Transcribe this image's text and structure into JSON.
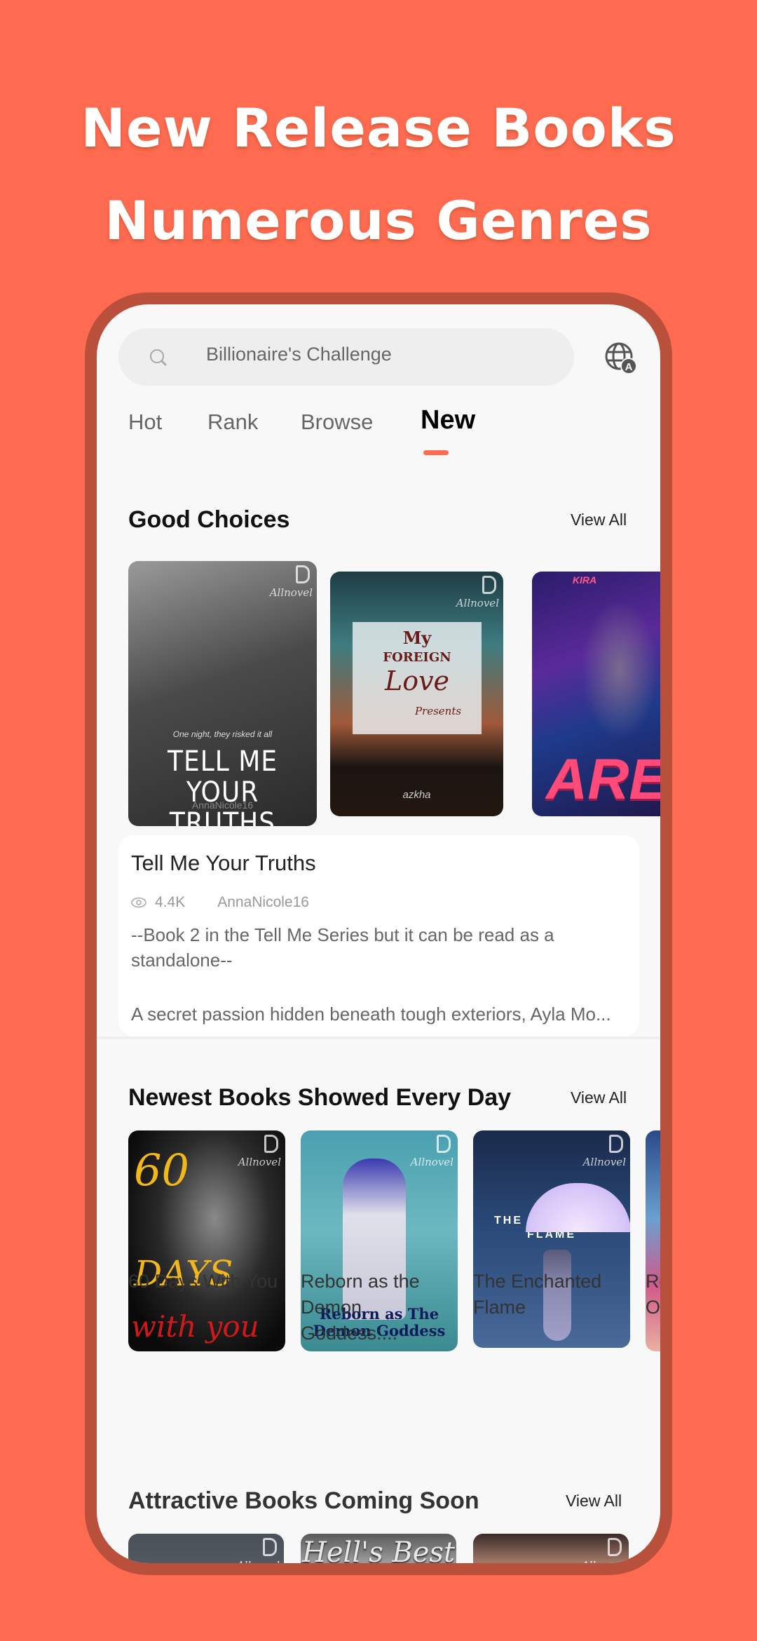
{
  "promo": {
    "line1": "New Release Books",
    "line2": "Numerous Genres",
    "background_color": "#FF6B50"
  },
  "search": {
    "icon": "search-icon",
    "value": "Billionaire's Challenge"
  },
  "language_button": {
    "icon": "globe-language-icon",
    "badge": "A"
  },
  "tabs": [
    {
      "label": "Hot",
      "active": false
    },
    {
      "label": "Rank",
      "active": false
    },
    {
      "label": "Browse",
      "active": false
    },
    {
      "label": "New",
      "active": true
    }
  ],
  "accent_color": "#FF6B50",
  "good_choices": {
    "title": "Good Choices",
    "view_all": "View All",
    "covers": [
      {
        "brand": "Allnovel",
        "tagline": "One night, they risked it all",
        "cover_title": "TELL ME YOUR TRUTHS",
        "cover_author": "AnnaNicole16"
      },
      {
        "brand": "Allnovel",
        "cover_title_1": "My",
        "cover_title_2": "FOREIGN",
        "cover_title_3": "Love",
        "cover_title_4": "Presents",
        "cover_author": "azkha"
      },
      {
        "cover_top": "KIRA",
        "cover_title": "ARES"
      }
    ],
    "selected": {
      "title": "Tell Me Your Truths",
      "views": "4.4K",
      "author": "AnnaNicole16",
      "description_1": "--Book 2 in the Tell Me Series but it can be read as a standalone--",
      "description_2": "A secret passion hidden beneath tough exteriors, Ayla Mo..."
    }
  },
  "newest": {
    "title": "Newest Books Showed Every Day",
    "view_all": "View All",
    "books": [
      {
        "title": "60 Days With You",
        "cover_1": "60",
        "cover_2": "DAYS",
        "cover_3": "with you",
        "brand": "Allnovel"
      },
      {
        "title": "Reborn as the Demon Goddess:...",
        "cover_1": "Reborn as The Demon Goddess",
        "brand": "Allnovel"
      },
      {
        "title": "The Enchanted Flame",
        "cover_1": "THE",
        "cover_2": "FLAME",
        "brand": "Allnovel"
      },
      {
        "title": "Re... O..."
      }
    ]
  },
  "coming_soon": {
    "title": "Attractive Books Coming Soon",
    "view_all": "View All",
    "covers": [
      {
        "brand": "Allnovel"
      },
      {
        "cover_title": "Hell's Best"
      },
      {
        "brand": "Allnovel"
      }
    ]
  }
}
